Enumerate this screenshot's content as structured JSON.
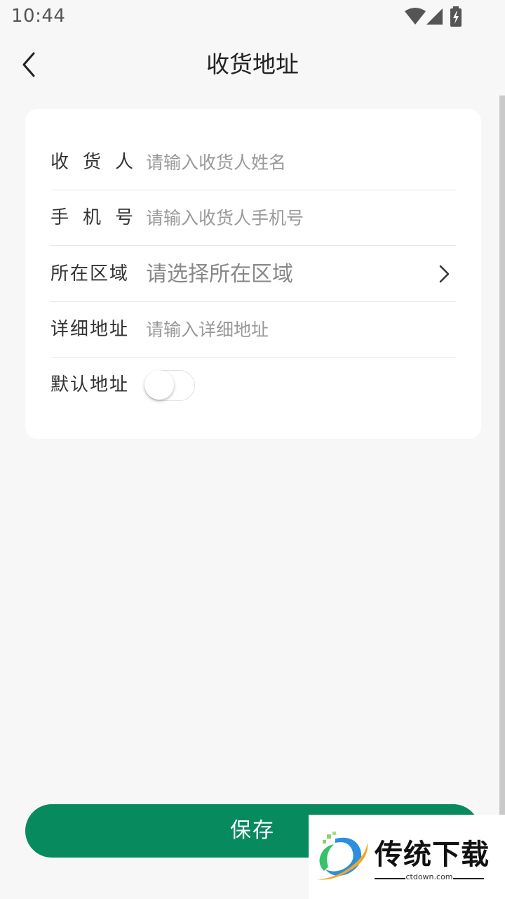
{
  "status_bar": {
    "time": "10:44",
    "icons": [
      "wifi-icon",
      "signal-icon",
      "battery-charging-icon"
    ]
  },
  "header": {
    "title": "收货地址",
    "back_icon": "chevron-left-icon"
  },
  "form": {
    "receiver": {
      "label": "收货人",
      "placeholder": "请输入收货人姓名",
      "value": ""
    },
    "phone": {
      "label": "手机号",
      "placeholder": "请输入收货人手机号",
      "value": ""
    },
    "region": {
      "label": "所在区域",
      "placeholder": "请选择所在区域",
      "value": "",
      "icon": "chevron-right-icon"
    },
    "detail": {
      "label": "详细地址",
      "placeholder": "请输入详细地址",
      "value": ""
    },
    "default_address": {
      "label": "默认地址",
      "enabled": false
    }
  },
  "actions": {
    "save_label": "保存"
  },
  "watermark": {
    "title": "传统下载",
    "site": "ctdown.com"
  },
  "colors": {
    "accent": "#078a5e",
    "background": "#f7f7f7",
    "card": "#ffffff",
    "placeholder": "#999999"
  }
}
